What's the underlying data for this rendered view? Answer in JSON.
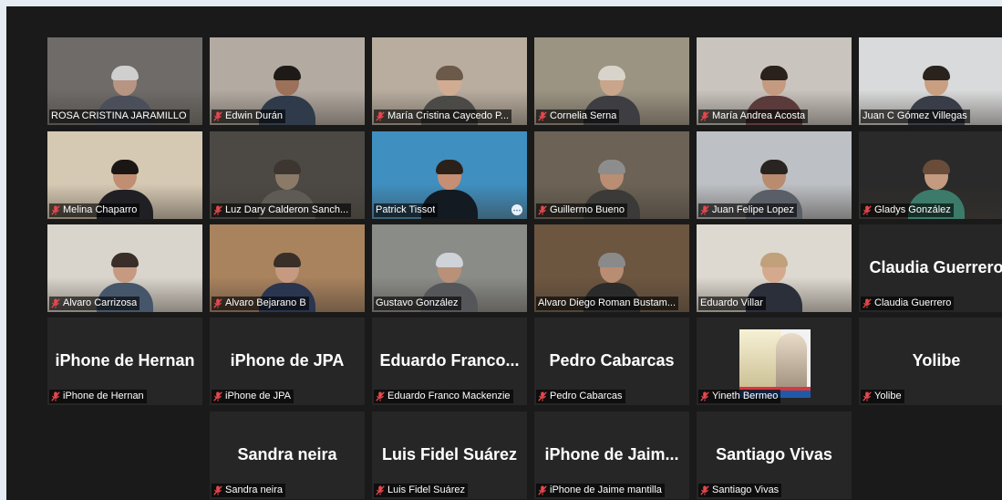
{
  "participants": [
    {
      "name": "ROSA CRISTINA JARAMILLO",
      "display": "",
      "muted": false,
      "video": true,
      "active": false,
      "bg": "#6e6b68",
      "skin": "#b89482",
      "hair": "#cfcfcf",
      "shirt": "#4a4f5a"
    },
    {
      "name": "Edwin Durán",
      "display": "",
      "muted": true,
      "video": true,
      "active": false,
      "bg": "#b3aba2",
      "skin": "#9b7259",
      "hair": "#1d1a18",
      "shirt": "#2f3a4a"
    },
    {
      "name": "María Cristina Caycedo P...",
      "display": "",
      "muted": true,
      "video": true,
      "active": false,
      "bg": "#b8ad9f",
      "skin": "#d2ac92",
      "hair": "#6b5a4a",
      "shirt": "#4c4a46"
    },
    {
      "name": "Cornelia Serna",
      "display": "",
      "muted": true,
      "video": true,
      "active": false,
      "bg": "#9c9483",
      "skin": "#c9a58c",
      "hair": "#d8d4cc",
      "shirt": "#3d3d42"
    },
    {
      "name": "María Andrea Acosta",
      "display": "",
      "muted": true,
      "video": true,
      "active": false,
      "bg": "#c9c4bd",
      "skin": "#c49a80",
      "hair": "#2b211c",
      "shirt": "#5a3a3a"
    },
    {
      "name": "Juan C Gómez Villegas",
      "display": "",
      "muted": false,
      "video": true,
      "active": false,
      "bg": "#d9dadb",
      "skin": "#c99f82",
      "hair": "#2a221c",
      "shirt": "#383d47"
    },
    {
      "name": "Melina Chaparro",
      "display": "",
      "muted": true,
      "video": true,
      "active": false,
      "bg": "#d6c9b4",
      "skin": "#c08f73",
      "hair": "#1b1614",
      "shirt": "#1f1f24"
    },
    {
      "name": "Luz Dary Calderon Sanch...",
      "display": "",
      "muted": true,
      "video": true,
      "active": false,
      "bg": "#4c4944",
      "skin": "#8c7a68",
      "hair": "#3c3530",
      "shirt": "#5e5a54"
    },
    {
      "name": "Patrick Tissot",
      "display": "",
      "muted": false,
      "video": true,
      "active": false,
      "bg": "#3f8fc0",
      "skin": "#c68f75",
      "hair": "#2b211b",
      "shirt": "#141a22"
    },
    {
      "name": "Guillermo Bueno",
      "display": "",
      "muted": true,
      "video": true,
      "active": false,
      "bg": "#6c6356",
      "skin": "#b98e73",
      "hair": "#8d8d8d",
      "shirt": "#3c3a38"
    },
    {
      "name": "Juan Felipe Lopez",
      "display": "",
      "muted": true,
      "video": true,
      "active": false,
      "bg": "#bdc0c4",
      "skin": "#b98b6f",
      "hair": "#2a2420",
      "shirt": "#5a5e66"
    },
    {
      "name": "Gladys González",
      "display": "",
      "muted": true,
      "video": true,
      "active": false,
      "bg": "#2a2a2a",
      "skin": "#c49a80",
      "hair": "#6a4c3a",
      "shirt": "#3c7a6a"
    },
    {
      "name": "Alvaro Carrizosa",
      "display": "",
      "muted": true,
      "video": true,
      "active": false,
      "bg": "#d9d4cc",
      "skin": "#c59a80",
      "hair": "#3a2f28",
      "shirt": "#46566a"
    },
    {
      "name": "Alvaro Bejarano B",
      "display": "",
      "muted": true,
      "video": true,
      "active": false,
      "bg": "#a9825e",
      "skin": "#c59a80",
      "hair": "#3a2f28",
      "shirt": "#2a3550"
    },
    {
      "name": "Gustavo González",
      "display": "",
      "muted": false,
      "video": true,
      "active": true,
      "bg": "#8a8c88",
      "skin": "#b99078",
      "hair": "#cfd2d6",
      "shirt": "#55565a"
    },
    {
      "name": "Alvaro Diego Roman Bustam...",
      "display": "",
      "muted": false,
      "video": true,
      "active": false,
      "bg": "#6d5640",
      "skin": "#b98d72",
      "hair": "#8a8a8a",
      "shirt": "#2b2b2b"
    },
    {
      "name": "Eduardo Villar",
      "display": "",
      "muted": false,
      "video": true,
      "active": false,
      "bg": "#ded9d0",
      "skin": "#d5a98e",
      "hair": "#c1a07c",
      "shirt": "#2b2f3a"
    },
    {
      "name": "Claudia Guerrero",
      "display": "Claudia Guerrero",
      "muted": true,
      "video": false,
      "active": false
    },
    {
      "name": "iPhone de Hernan",
      "display": "iPhone de Hernan",
      "muted": true,
      "video": false,
      "active": false
    },
    {
      "name": "iPhone de JPA",
      "display": "iPhone de JPA",
      "muted": true,
      "video": false,
      "active": false
    },
    {
      "name": "Eduardo Franco Mackenzie",
      "display": "Eduardo Franco...",
      "muted": true,
      "video": false,
      "active": false
    },
    {
      "name": "Pedro Cabarcas",
      "display": "Pedro Cabarcas",
      "muted": true,
      "video": false,
      "active": false
    },
    {
      "name": "Yineth Bermeo",
      "display": "",
      "muted": true,
      "video": false,
      "active": false,
      "poster": true
    },
    {
      "name": "Yolibe",
      "display": "Yolibe",
      "muted": true,
      "video": false,
      "active": false
    },
    {
      "name": "Sandra neira",
      "display": "Sandra neira",
      "muted": true,
      "video": false,
      "active": false
    },
    {
      "name": "Luis Fidel Suárez",
      "display": "Luis Fidel Suárez",
      "muted": true,
      "video": false,
      "active": false
    },
    {
      "name": "iPhone de Jaime mantilla",
      "display": "iPhone de Jaim...",
      "muted": true,
      "video": false,
      "active": false
    },
    {
      "name": "Santiago Vivas",
      "display": "Santiago Vivas",
      "muted": true,
      "video": false,
      "active": false
    }
  ],
  "colors": {
    "muted_icon": "#e5484d",
    "active_border": "#d9e86a"
  }
}
